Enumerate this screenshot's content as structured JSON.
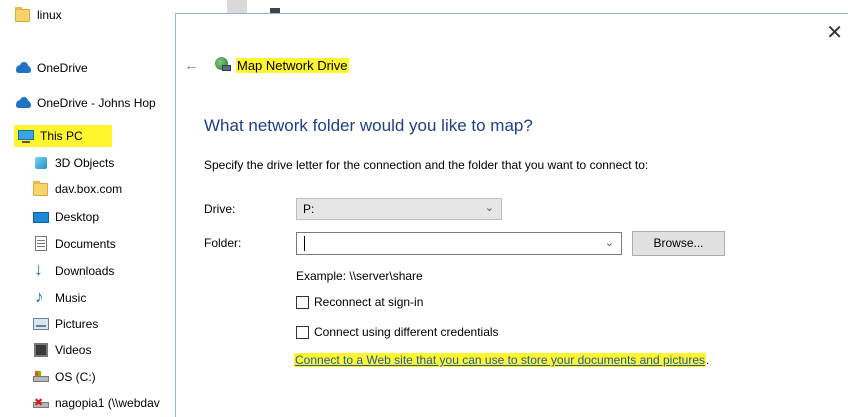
{
  "nav": {
    "items": [
      {
        "label": "linux",
        "icon": "folder-icon"
      },
      {
        "label": "OneDrive",
        "icon": "onedrive-cloud-icon"
      },
      {
        "label": "OneDrive - Johns Hop",
        "icon": "onedrive-cloud-icon"
      },
      {
        "label": "This PC",
        "icon": "this-pc-icon"
      },
      {
        "label": "3D Objects",
        "icon": "3d-objects-icon"
      },
      {
        "label": "dav.box.com",
        "icon": "folder-icon"
      },
      {
        "label": "Desktop",
        "icon": "desktop-icon"
      },
      {
        "label": "Documents",
        "icon": "documents-icon"
      },
      {
        "label": "Downloads",
        "icon": "downloads-icon"
      },
      {
        "label": "Music",
        "icon": "music-icon"
      },
      {
        "label": "Pictures",
        "icon": "pictures-icon"
      },
      {
        "label": "Videos",
        "icon": "videos-icon"
      },
      {
        "label": "OS (C:)",
        "icon": "drive-icon"
      },
      {
        "label": "nagopia1 (\\\\webdav",
        "icon": "network-drive-disconnected-icon"
      }
    ],
    "highlight_color": "#fff62e"
  },
  "dialog": {
    "title": "Map Network Drive",
    "close_glyph": "✕",
    "back_glyph": "←",
    "heading": "What network folder would you like to map?",
    "instruction": "Specify the drive letter for the connection and the folder that you want to connect to:",
    "drive_label": "Drive:",
    "drive_value": "P:",
    "folder_label": "Folder:",
    "folder_value": "",
    "browse_label": "Browse...",
    "example": "Example: \\\\server\\share",
    "reconnect_label": "Reconnect at sign-in",
    "reconnect_checked": false,
    "credentials_label": "Connect using different credentials",
    "credentials_checked": false,
    "link_text": "Connect to a Web site that you can use to store your documents and pictures",
    "link_suffix": ".",
    "heading_color": "#1e3f8a",
    "link_color": "#1e5aa8"
  }
}
